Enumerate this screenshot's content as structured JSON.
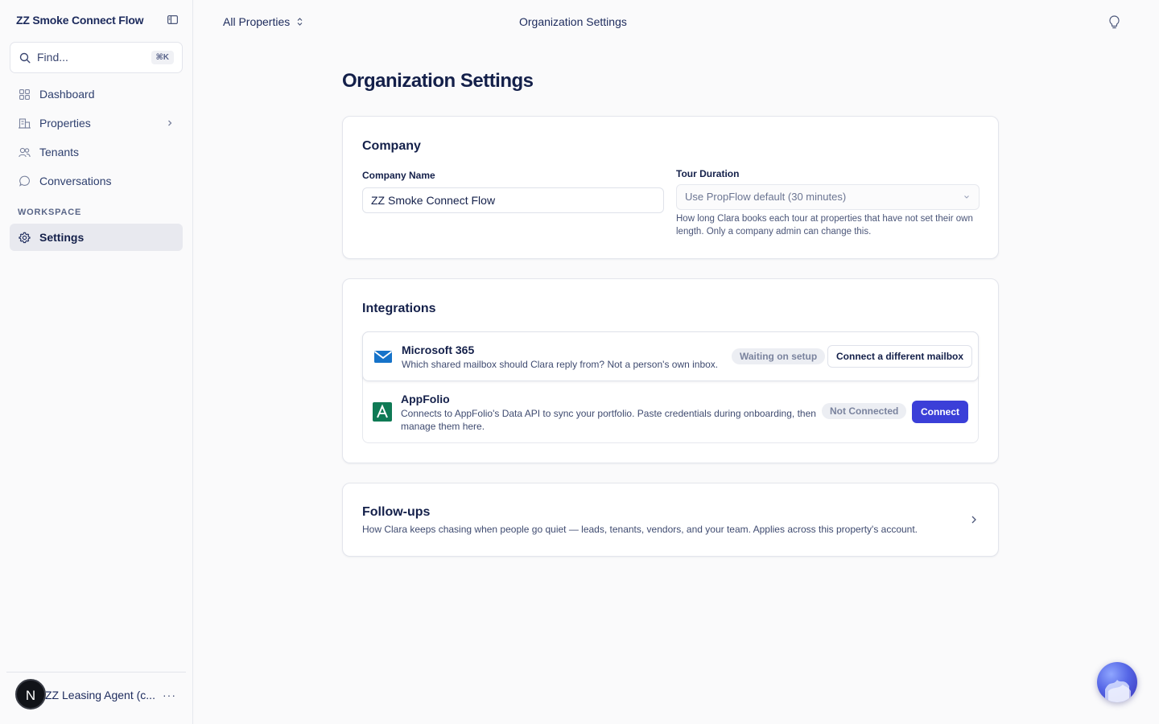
{
  "sidebar": {
    "workspace_title": "ZZ Smoke Connect Flow",
    "search": {
      "placeholder": "Find...",
      "shortcut": "⌘K"
    },
    "items": [
      {
        "label": "Dashboard",
        "icon": "grid-icon"
      },
      {
        "label": "Properties",
        "icon": "building-icon"
      },
      {
        "label": "Tenants",
        "icon": "users-icon"
      },
      {
        "label": "Conversations",
        "icon": "chat-icon"
      }
    ],
    "section_label": "WORKSPACE",
    "settings_label": "Settings",
    "user": {
      "initial": "N",
      "name": "ZZ Leasing Agent (c...",
      "more": "···"
    }
  },
  "topbar": {
    "property_switcher": "All Properties",
    "title": "Organization Settings"
  },
  "main": {
    "page_title": "Organization Settings",
    "company": {
      "heading": "Company",
      "company_name_label": "Company Name",
      "company_name_value": "ZZ Smoke Connect Flow",
      "tour_duration_label": "Tour Duration",
      "tour_duration_value": "Use PropFlow default (30 minutes)",
      "tour_duration_help": "How long Clara books each tour at properties that have not set their own length. Only a company admin can change this."
    },
    "integrations": {
      "heading": "Integrations",
      "microsoft": {
        "name": "Microsoft 365",
        "description": "Which shared mailbox should Clara reply from? Not a person's own inbox.",
        "status": "Waiting on setup",
        "action": "Connect a different mailbox"
      },
      "appfolio": {
        "name": "AppFolio",
        "description": "Connects to AppFolio's Data API to sync your portfolio. Paste credentials during onboarding, then manage them here.",
        "status": "Not Connected",
        "action": "Connect"
      }
    },
    "followups": {
      "heading": "Follow-ups",
      "description": "How Clara keeps chasing when people go quiet — leads, tenants, vendors, and your team. Applies across this property's account."
    }
  },
  "colors": {
    "primary": "#3b3fd8",
    "text": "#14204a",
    "microsoft_blue": "#1673c9",
    "appfolio_green": "#0f7a55"
  }
}
